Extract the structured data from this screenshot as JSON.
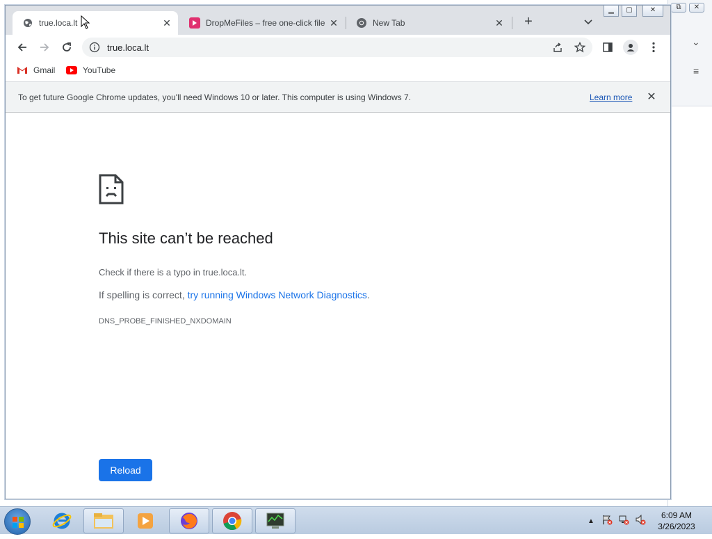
{
  "browser": {
    "tabs": [
      {
        "title": "true.loca.lt",
        "active": true
      },
      {
        "title": "DropMeFiles – free one-click file",
        "active": false
      },
      {
        "title": "New Tab",
        "active": false
      }
    ],
    "new_tab_symbol": "+",
    "address": "true.loca.lt",
    "bookmarks": [
      {
        "label": "Gmail",
        "icon": "gmail-icon"
      },
      {
        "label": "YouTube",
        "icon": "youtube-icon"
      }
    ],
    "infobar": {
      "message": "To get future Google Chrome updates, you'll need Windows 10 or later. This computer is using Windows 7.",
      "link": "Learn more"
    }
  },
  "error_page": {
    "title": "This site can’t be reached",
    "line1": "Check if there is a typo in true.loca.lt.",
    "line2_prefix": "If spelling is correct, ",
    "line2_link": "try running Windows Network Diagnostics",
    "line2_suffix": ".",
    "error_code": "DNS_PROBE_FINISHED_NXDOMAIN",
    "reload_label": "Reload"
  },
  "taskbar": {
    "time": "6:09 AM",
    "date": "3/26/2023",
    "apps": [
      "internet-explorer-icon",
      "file-explorer-icon",
      "media-player-icon",
      "firefox-icon",
      "chrome-icon",
      "network-monitor-icon"
    ]
  },
  "colors": {
    "accent": "#1a73e8",
    "tabstrip": "#dee1e6",
    "infobar": "#f1f3f4"
  }
}
